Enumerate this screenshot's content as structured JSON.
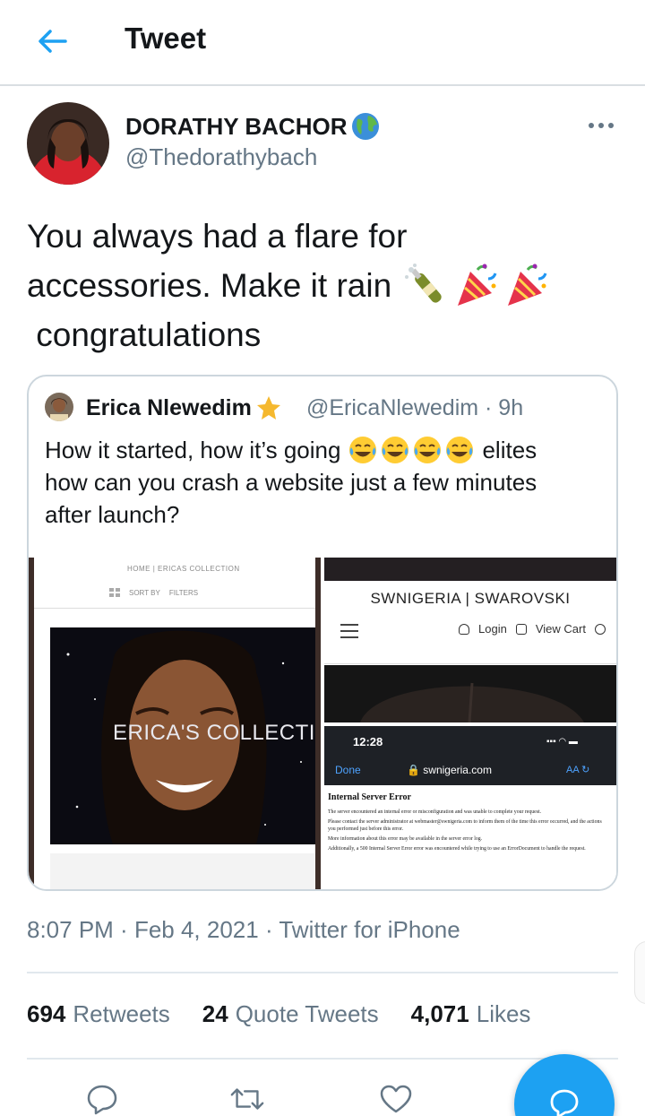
{
  "header": {
    "title": "Tweet"
  },
  "author": {
    "display_name": "DORATHY BACHOR",
    "handle": "@Thedorathybach",
    "badge_icon": "globe-emoji"
  },
  "tweet": {
    "lines": [
      "You always had a flare for",
      "accessories. Make it rain",
      " congratulations"
    ],
    "emojis": [
      "champagne-bottle-emoji",
      "party-popper-emoji",
      "party-popper-emoji"
    ]
  },
  "quote": {
    "display_name": "Erica Nlewedim",
    "badge_icon": "star-emoji",
    "handle_time": "@EricaNlewedim · 9h",
    "lines": [
      "How it started, how it’s going",
      "elites",
      "how can you crash a website just a few minutes",
      "after launch?"
    ],
    "laugh_emojis": [
      "laughing-crying-emoji",
      "laughing-crying-emoji",
      "laughing-crying-emoji",
      "laughing-crying-emoji"
    ],
    "media": {
      "left": {
        "breadcrumb": "HOME | ERICAS COLLECTION",
        "tools": [
          "SORT BY",
          "FILTERS"
        ],
        "hero_text": "ERICA'S COLLECTIOI"
      },
      "right_top": {
        "brand": "SWNIGERIA | SWAROVSKI",
        "login": "Login",
        "cart": "View Cart"
      },
      "right_bottom": {
        "time": "12:28",
        "done": "Done",
        "url": "swnigeria.com",
        "aa": "AA",
        "error_title": "Internal Server Error",
        "error_lines": [
          "The server encountered an internal error or misconfiguration and was unable to complete your request.",
          "Please contact the server administrator at webmaster@swnigeria.com to inform them of the time this error occurred, and the actions you performed just before this error.",
          "More information about this error may be available in the server error log.",
          "Additionally, a 500 Internal Server Error error was encountered while trying to use an ErrorDocument to handle the request."
        ]
      }
    }
  },
  "meta": {
    "time": "8:07 PM",
    "date": "Feb 4, 2021",
    "source": "Twitter for iPhone"
  },
  "stats": {
    "retweets_count": "694",
    "retweets_label": "Retweets",
    "quotes_count": "24",
    "quotes_label": "Quote Tweets",
    "likes_count": "4,071",
    "likes_label": "Likes"
  },
  "colors": {
    "accent": "#1da1f2",
    "text": "#14171a",
    "secondary": "#657786",
    "border": "#e1e8ed"
  }
}
